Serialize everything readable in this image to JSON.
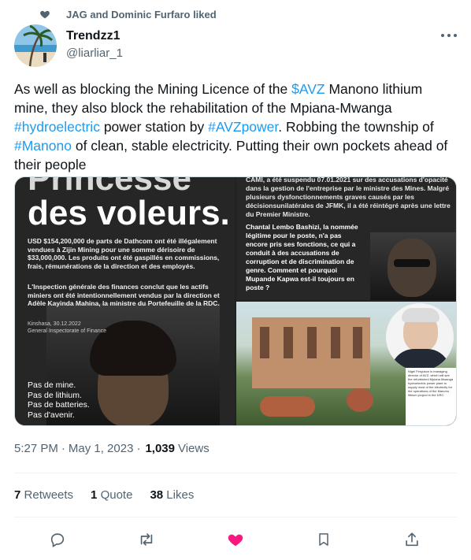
{
  "social_context": {
    "text": "JAG and Dominic Furfaro liked"
  },
  "author": {
    "display_name": "Trendzz1",
    "handle": "@liarliar_1"
  },
  "tweet": {
    "segments": [
      {
        "text": "As well as blocking the Mining Licence of the ",
        "link": false
      },
      {
        "text": "$AVZ",
        "link": true
      },
      {
        "text": " Manono lithium mine, they also block the rehabilitation of the Mpiana-Mwanga ",
        "link": false
      },
      {
        "text": "#hydroelectric",
        "link": true
      },
      {
        "text": " power station by ",
        "link": false
      },
      {
        "text": "#AVZpower",
        "link": true
      },
      {
        "text": ". Robbing the township of ",
        "link": false
      },
      {
        "text": "#Manono",
        "link": true
      },
      {
        "text": " of clean, stable electricity. Putting their own pockets ahead of their people",
        "link": false
      }
    ]
  },
  "media": {
    "left": {
      "headline_top": "Princesse",
      "headline": "des voleurs.",
      "paragraph1": "USD $154,200,000 de parts de Dathcom ont été illégalement vendues à Zijin Mining pour une somme dérisoire de $33,000,000. Les produits ont été gaspillés en commissions, frais, rémunérations de la direction et des employés.",
      "paragraph2": "L'Inspection générale des finances conclut que les actifs miniers ont été intentionnellement vendus par la direction et Adèle Kayinda Mahina, la ministre du Portefeuille de la RDC.",
      "dateline": "Kinshasa, 30.12.2022",
      "source": "General Inspectorate of Finance",
      "tagline": [
        "Pas de mine.",
        "Pas de lithium.",
        "Pas de batteries.",
        "Pas d'avenir."
      ]
    },
    "top_right": {
      "paragraph1": "CAMI, a été suspendu 07.01.2021 sur des accusations d'opacité dans la gestion de l'entreprise par le ministre des Mines. Malgré plusieurs dysfonctionnements graves causés par les décisionsunilatérales de JFMK, il a été réintégré après une lettre du Premier Ministre.",
      "paragraph2": "Chantal Lembo Bashizi, la nommée légitime pour le poste, n'a pas encore pris ses fonctions, ce qui a conduit à des accusations de corruption et de discrimination de genre. Comment et pourquoi Mupande Kapwa est-il toujours en poste ?"
    },
    "bottom_right": {
      "caption": "Nigel Ferguson is managing director of AVZ, which will see the refurbished Mpiana Mwanga hydroelectric power plant to supply most of the electricity for the operations of the Manono lithium project in the DRC."
    }
  },
  "meta": {
    "time": "5:27 PM",
    "separator": "·",
    "date": "May 1, 2023",
    "separator2": "·",
    "views_count": "1,039",
    "views_label": "Views"
  },
  "stats": {
    "retweets_count": "7",
    "retweets_label": "Retweets",
    "quotes_count": "1",
    "quotes_label": "Quote",
    "likes_count": "38",
    "likes_label": "Likes"
  },
  "actions": {
    "reply_icon": "reply-icon",
    "retweet_icon": "retweet-icon",
    "like_icon": "heart-filled-icon",
    "bookmark_icon": "bookmark-icon",
    "share_icon": "share-icon",
    "like_color": "#f91880"
  }
}
